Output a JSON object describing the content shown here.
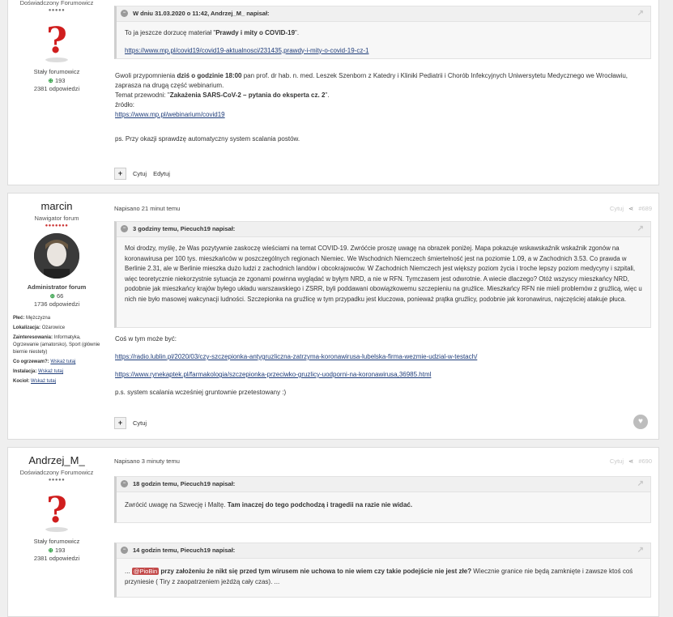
{
  "post1": {
    "user_title": "Doświadczony Forumowicz",
    "stars": "●●●●●",
    "rank": "Stały forumowicz",
    "rep": "193",
    "answers": "2381 odpowiedzi",
    "quote_header": "W dniu 31.03.2020 o 11:42, Andrzej_M_ napisał:",
    "quote_text_pre": "To ja jeszcze dorzucę materiał  \"",
    "quote_text_bold": "Prawdy i mity o COVID-19",
    "quote_text_post": "\".",
    "quote_link": "https://www.mp.pl/covid19/covid19-aktualnosci/231435,prawdy-i-mity-o-covid-19-cz-1",
    "p1_pre": " Gwoli przypomnienia ",
    "p1_bold": "dziś o godzinie 18:00",
    "p1_post": " pan prof. dr hab. n. med. Leszek Szenborn z Katedry i Kliniki Pediatrii i Chorób Infekcyjnych Uniwersytetu Medycznego we Wrocławiu, zaprasza na drugą część webinarium.",
    "p2_pre": "Temat przewodni: \"",
    "p2_bold": "Zakażenia SARS-CoV-2 – pytania do eksperta cz. 2",
    "p2_post": "\".",
    "p3": "źródło:",
    "p3_link": "https://www.mp.pl/webinarium/covid19",
    "p4": "ps. Przy okazji sprawdzę automatyczny system scalania postów.",
    "action_quote": "Cytuj",
    "action_edit": "Edytuj"
  },
  "post2": {
    "username": "marcin",
    "user_title": "Nawigator forum",
    "stars": "●●●●●●●",
    "rank": "Administrator forum",
    "rep": "66",
    "answers": "1736 odpowiedzi",
    "profile": [
      {
        "k": "Płeć:",
        "v": "Mężczyzna"
      },
      {
        "k": "Lokalizacja:",
        "v": "Ożarowice"
      },
      {
        "k": "Zainteresowania:",
        "v": "Informatyka, Ogrzewanie (amatorsko), Sport (głównie biernie niestety)"
      },
      {
        "k": "Co ogrzewam?:",
        "v": "Wskaż tutaj"
      },
      {
        "k": "Instalacja:",
        "v": "Wskaż tutaj"
      },
      {
        "k": "Kocioł:",
        "v": "Wskaż tutaj"
      }
    ],
    "posted": "Napisano 21 minut temu",
    "tools_quote": "Cytuj",
    "post_number": "#689",
    "quote_header": "3 godziny temu, Piecuch19 napisał:",
    "quote_text": "Moi drodzy, myślę, że Was pozytywnie zaskoczę wieściami na temat COVID-19. Zwróćcie proszę uwagę na obrazek poniżej. Mapa pokazuje wskawskaźnik wskaźnik zgonów na koronawirusa per 100 tys. mieszkańców w poszczególnych regionach Niemiec. We Wschodnich Niemczech śmiertelność jest na poziomie 1.09, a w Zachodnich 3.53. Co prawda w Berlinie 2.31, ale w Berlinie mieszka dużo ludzi z zachodnich landów i obcokrajowców. W Zachodnich Niemczech jest większy poziom życia i troche lepszy poziom medycyny i szpitali, więc teoretycznie niekorzystnie sytuacja ze zgonami powinna wyglądać w byłym NRD, a nie w RFN. Tymczasem jest odwrotnie. A wiecie dlaczego? Otóż wszyscy mieszkańcy NRD, podobnie jak mieszkańcy krajów byłego układu warszawskiego i ZSRR, byli poddawani obowiązkowemu szczepieniu na gruźlice. Mieszkańcy RFN nie mieli problemów z gruźlicą, więc u nich nie było masowej wakcynacji ludności. Szczepionka na gruźlicę w tym przypadku jest kluczowa, ponieważ prątka gruźlicy, podobnie jak koronawirus, najczęściej atakuje płuca.",
    "p1": "Coś w tym może być:",
    "link1": "https://radio.lublin.pl/2020/03/czy-szczepionka-antygruzliczna-zatrzyma-koronawirusa-lubelska-firma-wezmie-udzial-w-testach/",
    "link2": "https://www.rynekaptek.pl/farmakologia/szczepionka-przeciwko-gruzlicy-uodporni-na-koronawirusa,36985.html",
    "p2": "p.s. system scalania wcześniej gruntownie przetestowany :)",
    "action_quote": "Cytuj"
  },
  "post3": {
    "username": "Andrzej_M_",
    "user_title": "Doświadczony Forumowicz",
    "stars": "●●●●●",
    "rank": "Stały forumowicz",
    "rep": "193",
    "answers": "2381 odpowiedzi",
    "posted": "Napisano 3 minuty temu",
    "tools_quote": "Cytuj",
    "post_number": "#690",
    "quote1_header": "18 godzin temu, Piecuch19 napisał:",
    "quote1_pre": "Zwrócić uwagę na Szwecję i Maltę. ",
    "quote1_bold": "Tam inaczej do tego podchodzą i tragedii na razie nie widać.",
    "quote2_header": "14 godzin temu, Piecuch19 napisał:",
    "quote2_lead": "... ",
    "quote2_mention": "@PioBin",
    "quote2_bold": " przy założeniu że nikt się przed tym wirusem nie uchowa to nie wiem czy takie podejście nie jest złe?",
    "quote2_post": " Wiecznie granice nie będą zamknięte i zawsze ktoś coś przyniesie ( Tiry z zaopatrzeniem jeżdżą cały czas). ..."
  }
}
